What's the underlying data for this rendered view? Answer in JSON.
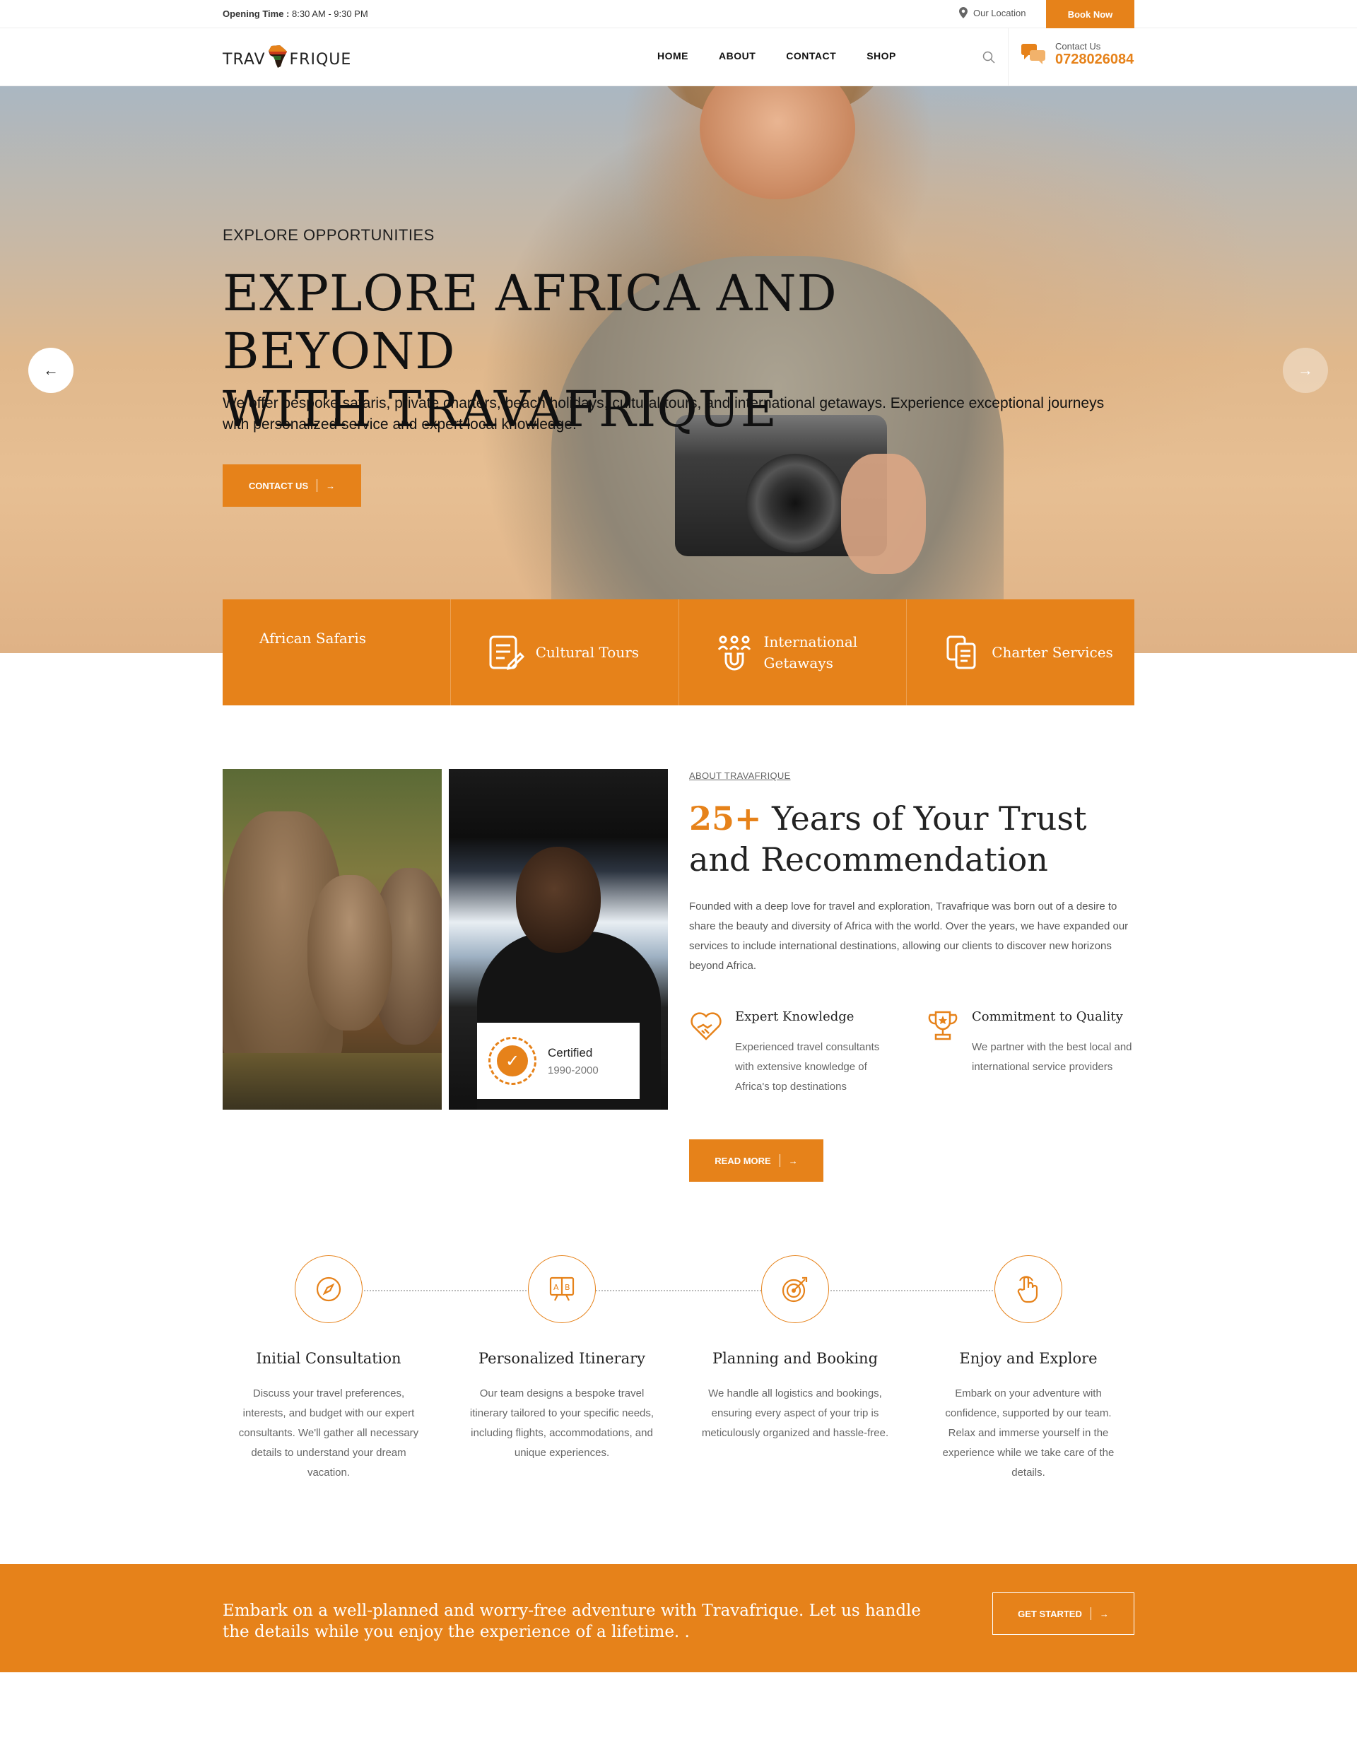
{
  "topbar": {
    "opening_label": "Opening Time :",
    "opening_hours": "8:30 AM - 9:30 PM",
    "location": "Our Location",
    "book_now": "Book Now"
  },
  "nav": {
    "logo_left": "TRAV",
    "logo_right": "FRIQUE",
    "items": [
      "HOME",
      "ABOUT",
      "CONTACT",
      "SHOP"
    ],
    "contact_label": "Contact Us",
    "contact_phone": "0728026084"
  },
  "hero": {
    "overline": "EXPLORE OPPORTUNITIES",
    "title_line1": "EXPLORE AFRICA AND BEYOND",
    "title_line2": "WITH TRAVAFRIQUE",
    "description": "We offer bespoke safaris, private charters, beach holidays, cultural tours, and international getaways. Experience exceptional journeys with personalized service and expert local knowledge.",
    "cta": "CONTACT US",
    "prev_arrow": "←",
    "next_arrow": "→"
  },
  "services": [
    {
      "label": "African Safaris",
      "icon": "none"
    },
    {
      "label": "Cultural Tours",
      "icon": "list-edit-icon"
    },
    {
      "label": "International Getaways",
      "icon": "people-magnet-icon"
    },
    {
      "label": "Charter Services",
      "icon": "documents-icon"
    }
  ],
  "about": {
    "kicker": "ABOUT TRAVAFRIQUE",
    "title_num": "25+",
    "title_rest": " Years of Your Trust and Recommendation",
    "body": "Founded with a deep love for travel and exploration, Travafrique was born out of a desire to share the beauty and diversity of Africa with the world. Over the years, we have expanded our services to include international destinations, allowing our clients to discover new horizons beyond Africa.",
    "certified": "Certified",
    "certified_years": "1990-2000",
    "features": [
      {
        "title": "Expert Knowledge",
        "desc": "Experienced travel consultants with extensive knowledge of Africa's top destinations",
        "icon": "handshake-heart-icon"
      },
      {
        "title": "Commitment to Quality",
        "desc": "We partner with the best local and international service providers",
        "icon": "trophy-icon"
      }
    ],
    "read_more": "READ MORE"
  },
  "steps": [
    {
      "title": "Initial Consultation",
      "desc": "Discuss your travel preferences, interests, and budget with our expert consultants. We'll gather all necessary details to understand your dream vacation.",
      "icon": "compass-icon"
    },
    {
      "title": "Personalized Itinerary",
      "desc": "Our team designs a bespoke travel itinerary tailored to your specific needs, including flights, accommodations, and unique experiences.",
      "icon": "ab-board-icon"
    },
    {
      "title": "Planning and Booking",
      "desc": "We handle all logistics and bookings, ensuring every aspect of your trip is meticulously organized and hassle-free.",
      "icon": "target-icon"
    },
    {
      "title": "Enjoy and Explore",
      "desc": "Embark on your adventure with confidence, supported by our team. Relax and immerse yourself in the experience while we take care of the details.",
      "icon": "hand-pointer-icon"
    }
  ],
  "banner": {
    "text": "Embark on a well-planned and worry-free adventure with Travafrique. Let us handle the details while you enjoy the experience of a lifetime. .",
    "cta": "GET STARTED"
  },
  "colors": {
    "accent": "#e6821a"
  }
}
